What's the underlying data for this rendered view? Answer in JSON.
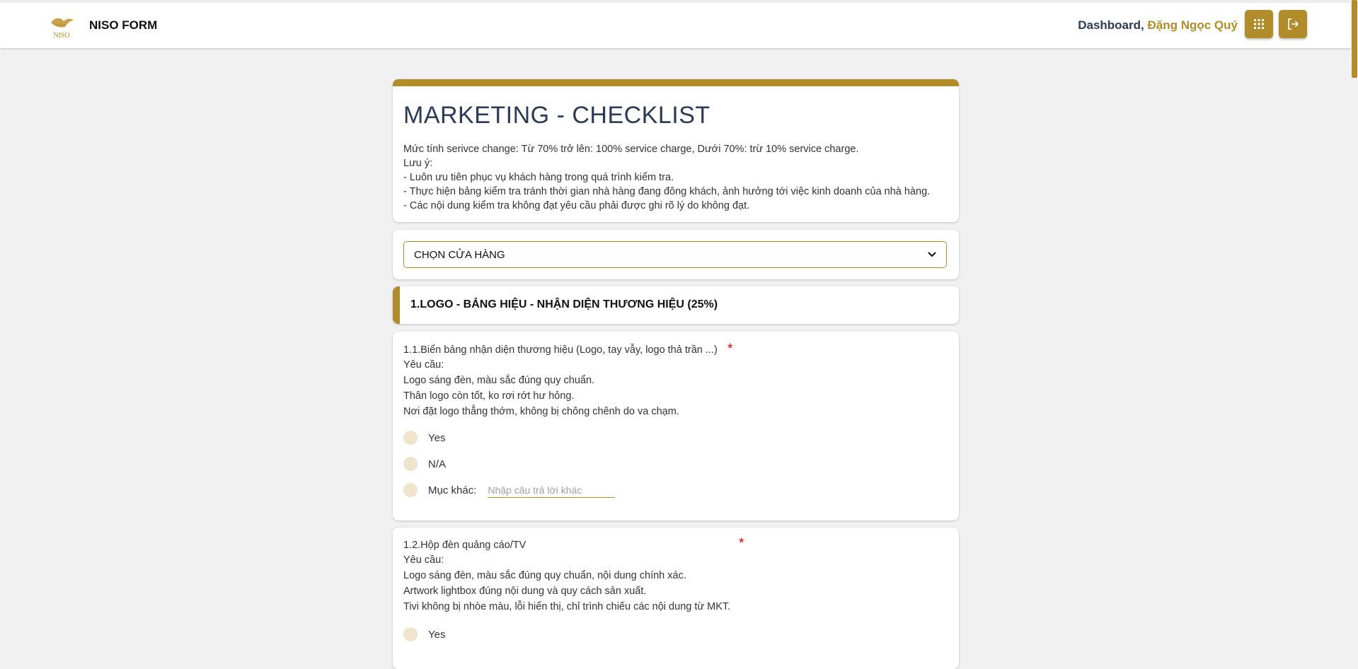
{
  "header": {
    "brand": "NISO FORM",
    "logo_text": "NISO",
    "dashboard_label": "Dashboard,",
    "user_name": "Đặng Ngọc Quý",
    "apps_icon": "grid-icon",
    "logout_icon": "logout-icon"
  },
  "form": {
    "title": "MARKETING - CHECKLIST",
    "description": [
      "Mức tính serivce change: Từ 70% trở lên: 100% service charge, Dưới 70%: trừ 10% service charge.",
      "Lưu ý:",
      "- Luôn ưu tiên phục vụ khách hàng trong quá trình kiểm tra.",
      "- Thực hiện bảng kiểm tra tránh thời gian nhà hàng đang đông khách, ảnh hưởng tới việc kinh doanh của nhà hàng.",
      "- Các nội dung kiểm tra không đạt yêu cầu phải được ghi rõ lý do không đạt."
    ],
    "store_select": {
      "selected": "CHỌN CỬA HÀNG"
    },
    "section_title": "1.LOGO - BẢNG HIỆU - NHẬN DIỆN THƯƠNG HIỆU (25%)",
    "required_mark": "*",
    "questions": [
      {
        "title": "1.1.Biển bảng nhận diện thương hiệu (Logo, tay vẫy, logo thả trần ...)",
        "requirements": [
          "Yêu cầu:",
          "Logo sáng đèn, màu sắc đúng quy chuẩn.",
          "Thân logo còn tốt, ko rơi rớt hư hỏng.",
          "Nơi đặt logo thẳng thớm, không bị chông chênh do va chạm."
        ],
        "options": [
          "Yes",
          "N/A",
          "Mục khác:"
        ],
        "other_placeholder": "Nhập câu trả lời khác"
      },
      {
        "title": "1.2.Hộp đèn quảng cáo/TV",
        "requirements": [
          "Yêu cầu:",
          "Logo sáng đèn, màu sắc đúng quy chuẩn, nội dung chính xác.",
          "Artwork lightbox đúng nội dung và quy cách sản xuất.",
          "Tivi không bị nhòe màu, lỗi hiển thị, chỉ trình chiếu các nội dung từ MKT."
        ],
        "options": [
          "Yes"
        ]
      }
    ]
  },
  "colors": {
    "accent": "#b08d2a",
    "title_text": "#2b3a55",
    "required": "#e00000",
    "radio_fill": "#efe4cc",
    "background": "#f1f1f1"
  }
}
